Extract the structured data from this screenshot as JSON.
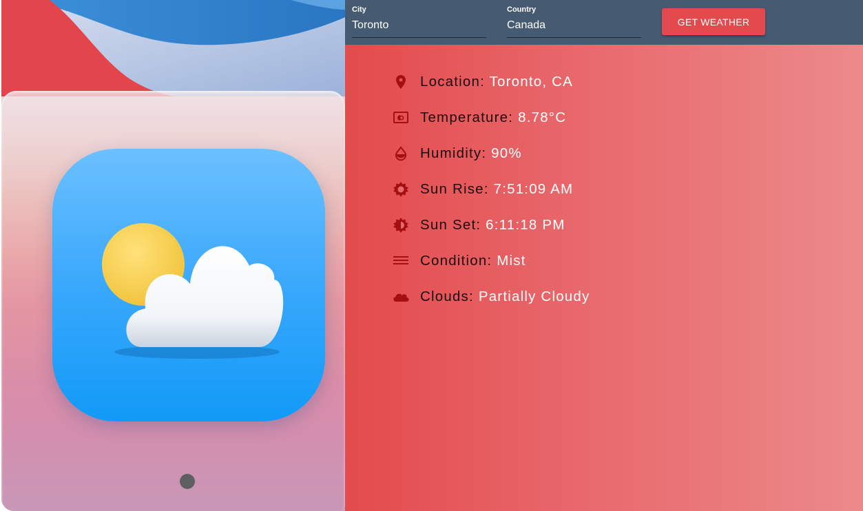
{
  "form": {
    "city_label": "City",
    "city_value": "Toronto",
    "country_label": "Country",
    "country_value": "Canada",
    "submit_label": "GET WEATHER"
  },
  "weather": {
    "location": {
      "icon": "location-pin-icon",
      "label": "Location:",
      "value": "Toronto, CA"
    },
    "temperature": {
      "icon": "thermostat-icon",
      "label": "Temperature:",
      "value": "8.78°C"
    },
    "humidity": {
      "icon": "water-drop-icon",
      "label": "Humidity:",
      "value": "90%"
    },
    "sunrise": {
      "icon": "sun-icon",
      "label": "Sun Rise:",
      "value": "7:51:09 AM"
    },
    "sunset": {
      "icon": "sun-half-icon",
      "label": "Sun Set:",
      "value": "6:11:18 PM"
    },
    "condition": {
      "icon": "menu-lines-icon",
      "label": "Condition:",
      "value": "Mist"
    },
    "clouds": {
      "icon": "cloud-icon",
      "label": "Clouds:",
      "value": "Partially Cloudy"
    }
  },
  "colors": {
    "toolbar_bg": "#465a72",
    "button_bg": "#e34a4e",
    "panel_gradient_start": "#e34b4c",
    "panel_gradient_end": "#ec8a8a",
    "icon_color": "#a50f12",
    "label_color": "#1b0c10",
    "value_color": "#ffffff"
  }
}
